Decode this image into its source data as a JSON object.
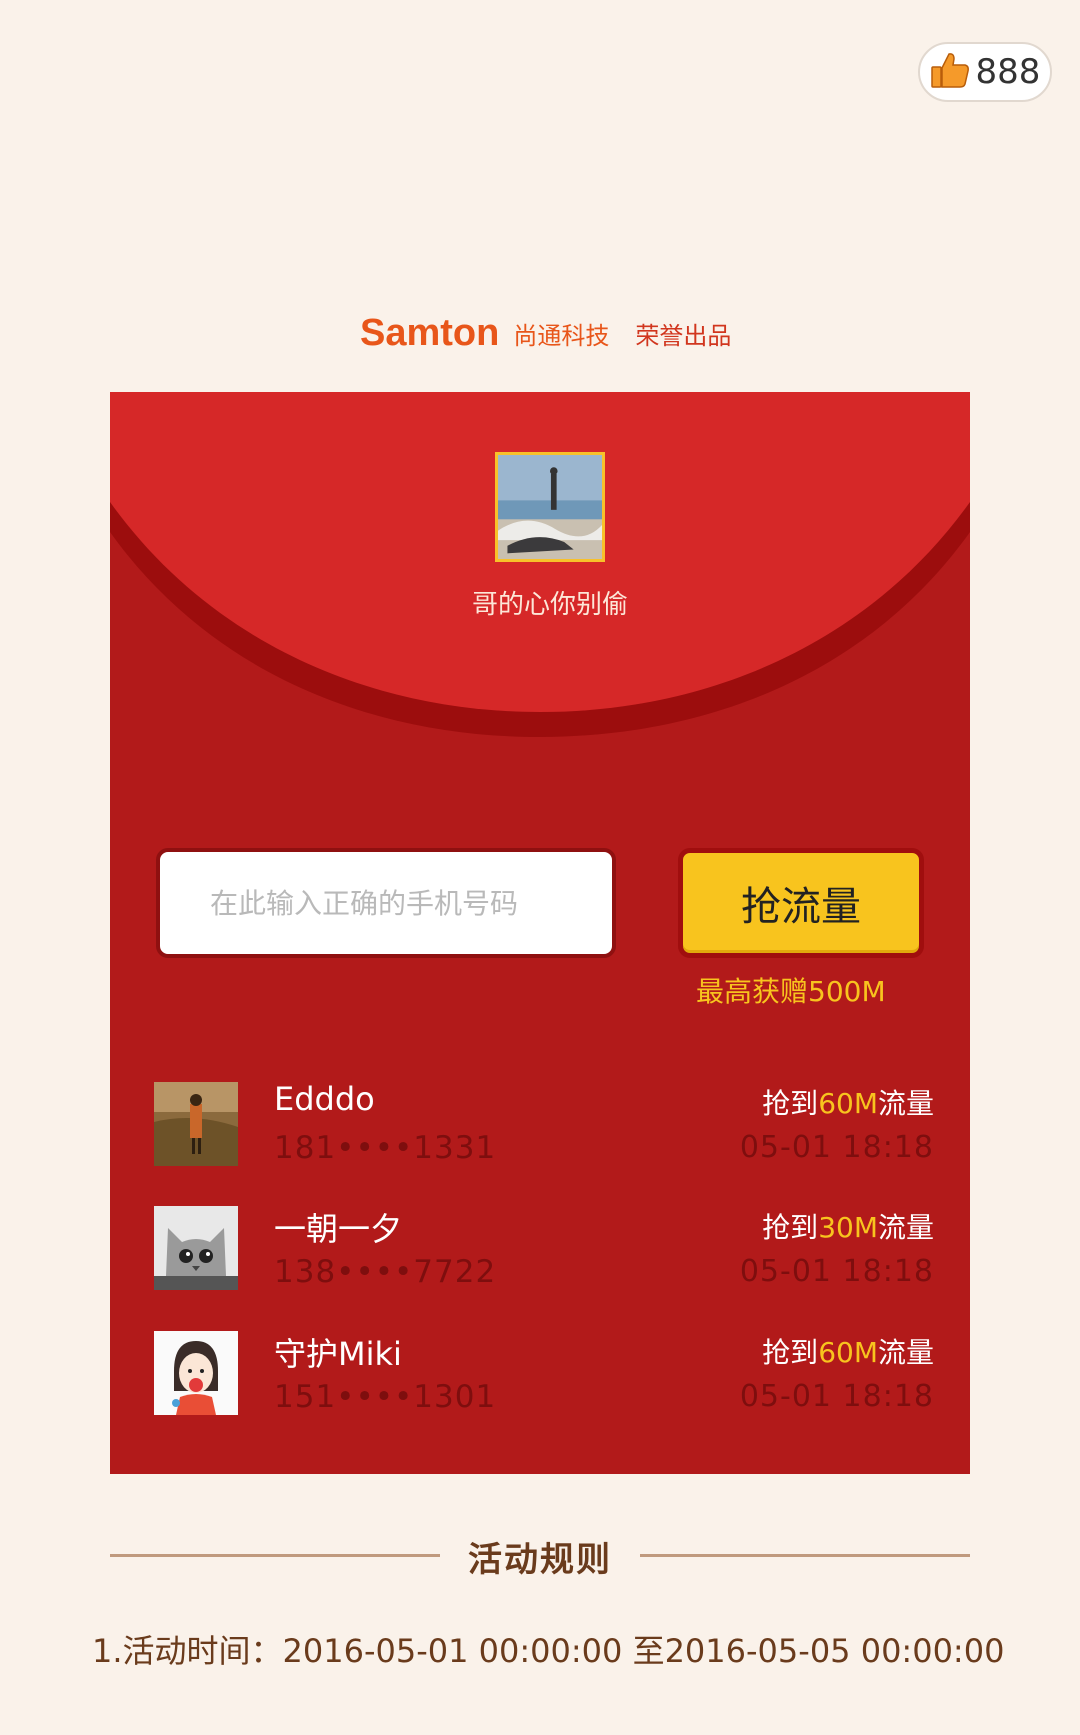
{
  "like_badge": {
    "count": "888",
    "icon": "thumbs-up-icon"
  },
  "brand": {
    "logo_text": "Samton",
    "company": "尚通科技",
    "slogan": "荣誉出品"
  },
  "envelope": {
    "host_name": "哥的心你别偷",
    "phone_placeholder": "在此输入正确的手机号码",
    "grab_button": "抢流量",
    "max_gift": "最高获赠500M"
  },
  "winners": [
    {
      "name": "Edddo",
      "phone": "181••••1331",
      "prize_prefix": "抢到",
      "prize_amount": "60M",
      "prize_suffix": "流量",
      "time": "05-01 18:18"
    },
    {
      "name": "一朝一夕",
      "phone": "138••••7722",
      "prize_prefix": "抢到",
      "prize_amount": "30M",
      "prize_suffix": "流量",
      "time": "05-01 18:18"
    },
    {
      "name": "守护Miki",
      "phone": "151••••1301",
      "prize_prefix": "抢到",
      "prize_amount": "60M",
      "prize_suffix": "流量",
      "time": "05-01 18:18"
    }
  ],
  "rules": {
    "title": "活动规则",
    "items": [
      "1.活动时间：2016-05-01 00:00:00 至2016-05-05 00:00:00"
    ]
  },
  "colors": {
    "background": "#faf2ea",
    "envelope_red": "#b21a1a",
    "envelope_top": "#d62828",
    "accent_yellow": "#f8c41e",
    "brand_orange": "#e8561a"
  }
}
